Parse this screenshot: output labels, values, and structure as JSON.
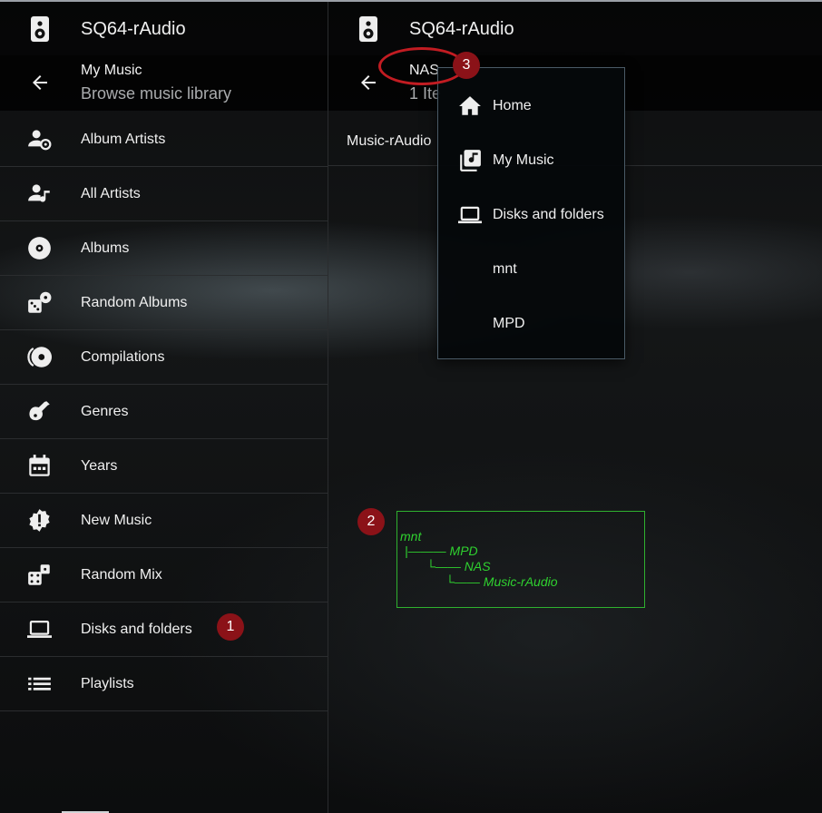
{
  "left_pane": {
    "app_title": "SQ64-rAudio",
    "subheader": {
      "title": "My Music",
      "subtitle": "Browse music library"
    },
    "items": [
      {
        "label": "Album Artists",
        "icon": "album-artists-icon"
      },
      {
        "label": "All Artists",
        "icon": "all-artists-icon"
      },
      {
        "label": "Albums",
        "icon": "album-disc-icon"
      },
      {
        "label": "Random Albums",
        "icon": "random-albums-icon"
      },
      {
        "label": "Compilations",
        "icon": "compilations-icon"
      },
      {
        "label": "Genres",
        "icon": "guitar-icon"
      },
      {
        "label": "Years",
        "icon": "calendar-icon"
      },
      {
        "label": "New Music",
        "icon": "new-badge-icon"
      },
      {
        "label": "Random Mix",
        "icon": "dice-icon"
      },
      {
        "label": "Disks and folders",
        "icon": "laptop-icon"
      },
      {
        "label": "Playlists",
        "icon": "list-icon"
      }
    ]
  },
  "right_pane": {
    "app_title": "SQ64-rAudio",
    "subheader": {
      "title": "NAS",
      "subtitle": "1 Ite"
    },
    "breadcrumb": "Music-rAudio"
  },
  "dropdown_menu": {
    "items": [
      {
        "label": "Home",
        "icon": "home-icon"
      },
      {
        "label": "My Music",
        "icon": "music-library-icon"
      },
      {
        "label": "Disks and folders",
        "icon": "laptop-icon"
      },
      {
        "label": "mnt",
        "icon": ""
      },
      {
        "label": "MPD",
        "icon": ""
      }
    ]
  },
  "annotations": {
    "badges": [
      "1",
      "2",
      "3"
    ],
    "tree_lines": [
      "mnt",
      "|——— MPD",
      "└—— NAS",
      "└—— Music-rAudio"
    ],
    "colors": {
      "badge": "#8b1218",
      "ellipse": "#c21c22",
      "tree": "#2fd12f"
    }
  }
}
